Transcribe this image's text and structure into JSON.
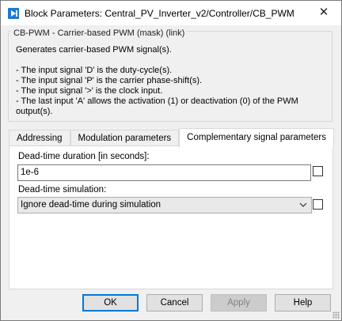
{
  "window": {
    "title": "Block Parameters: Central_PV_Inverter_v2/Controller/CB_PWM",
    "close_glyph": "✕"
  },
  "mask": {
    "legend": "CB-PWM - Carrier-based PWM (mask) (link)",
    "description": [
      "Generates carrier-based PWM signal(s).",
      "",
      "- The input signal 'D' is the duty-cycle(s).",
      "- The input signal 'P' is the carrier phase-shift(s).",
      "- The input signal '>' is the clock input.",
      "- The last input 'A' allows the activation (1) or deactivation (0) of the PWM output(s)."
    ]
  },
  "tabs": [
    {
      "label": "Addressing",
      "active": false
    },
    {
      "label": "Modulation parameters",
      "active": false
    },
    {
      "label": "Complementary signal parameters",
      "active": true
    }
  ],
  "params": {
    "deadtime_label": "Dead-time duration [in seconds]:",
    "deadtime_value": "1e-6",
    "deadtime_checked": false,
    "sim_label": "Dead-time simulation:",
    "sim_value": "Ignore dead-time during simulation",
    "sim_checked": false
  },
  "buttons": {
    "ok": "OK",
    "cancel": "Cancel",
    "apply": "Apply",
    "help": "Help"
  },
  "icons": {
    "app": "simulink-block-icon",
    "close": "close-icon",
    "dropdown": "chevron-down-icon",
    "grip": "resize-grip-icon"
  }
}
